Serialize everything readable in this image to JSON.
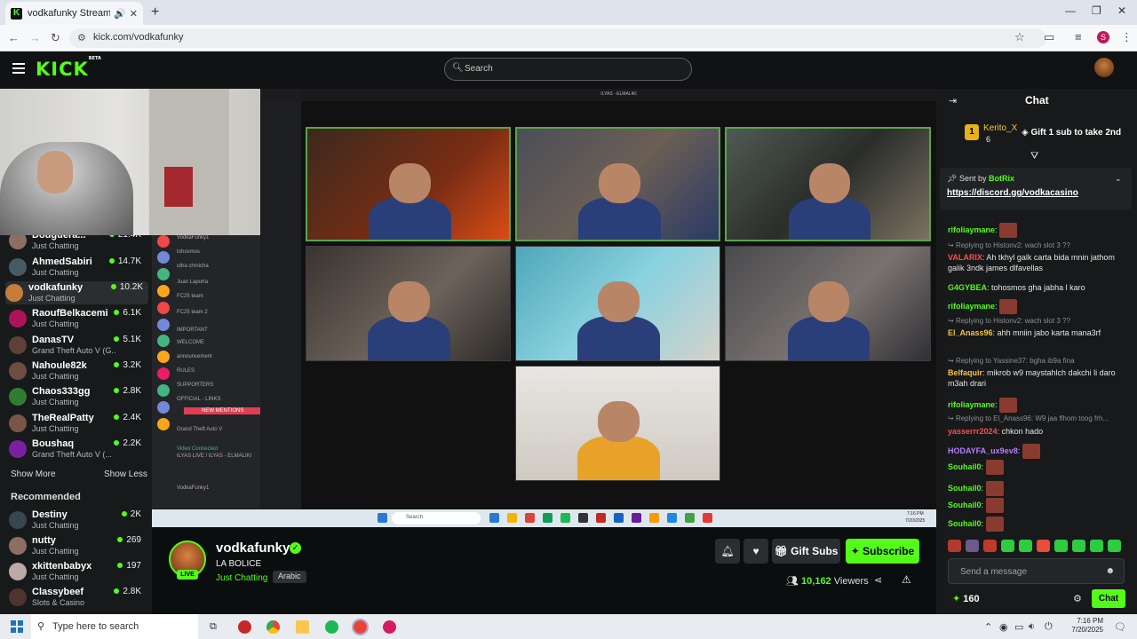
{
  "browser": {
    "tab_title": "vodkafunky Stream - Watch",
    "url": "kick.com/vodkafunky",
    "profile_initial": "S"
  },
  "kick": {
    "logo": "KICK",
    "logo_badge": "BETA",
    "search_placeholder": "Search"
  },
  "sidebar": {
    "following": [
      {
        "name": "Douguera...",
        "category": "Just Chatting",
        "viewers": "21.4K",
        "color": "#8d6e63"
      },
      {
        "name": "AhmedSabiri",
        "category": "Just Chatting",
        "viewers": "14.7K",
        "color": "#455a64"
      },
      {
        "name": "vodkafunky",
        "category": "Just Chatting",
        "viewers": "10.2K",
        "color": "#c77d3a"
      },
      {
        "name": "RaoufBelkacemi",
        "category": "Just Chatting",
        "viewers": "6.1K",
        "color": "#ad1457"
      },
      {
        "name": "DanasTV",
        "category": "Grand Theft Auto V (G...",
        "viewers": "5.1K",
        "color": "#5d4037"
      },
      {
        "name": "Nahoule82k",
        "category": "Just Chatting",
        "viewers": "3.2K",
        "color": "#6d4c41"
      },
      {
        "name": "Chaos333gg",
        "category": "Just Chatting",
        "viewers": "2.8K",
        "color": "#2e7d32"
      },
      {
        "name": "TheRealPatty",
        "category": "Just Chatting",
        "viewers": "2.4K",
        "color": "#795548"
      },
      {
        "name": "Boushaq",
        "category": "Grand Theft Auto V (...",
        "viewers": "2.2K",
        "color": "#7b1fa2"
      }
    ],
    "show_more": "Show More",
    "show_less": "Show Less",
    "recommended_title": "Recommended",
    "recommended": [
      {
        "name": "Destiny",
        "category": "Just Chatting",
        "viewers": "2K",
        "color": "#37474f"
      },
      {
        "name": "nutty",
        "category": "Just Chatting",
        "viewers": "269",
        "color": "#8d6e63"
      },
      {
        "name": "xkittenbabyx",
        "category": "Just Chatting",
        "viewers": "197",
        "color": "#bcaaa4"
      },
      {
        "name": "Classybeef",
        "category": "Slots & Casino",
        "viewers": "2.8K",
        "color": "#4e342e"
      }
    ]
  },
  "stream": {
    "discord_window_title": "ILYAS - ELMALIKI",
    "discord_labels": [
      "VodkaFunky1",
      "tohosmos",
      "ultra chmicha",
      "Juan Laporta",
      "FC25 team",
      "FC25 team 2",
      "IMPORTANT",
      "WELCOME",
      "announcement",
      "RULES",
      "SUPPORTERS",
      "OFFICIAL - LINKS",
      "NEW MENTIONS",
      "Grand Theft Auto V",
      "Video Connected",
      "ILYAS LIVE / ILYAS - ELMALIKI",
      "VodkaFunky1"
    ],
    "taskbar_search": "Search",
    "inner_time": "7:16 PM",
    "inner_date": "7/20/2025"
  },
  "channel": {
    "name": "vodkafunky",
    "title": "LA BOLICE",
    "category": "Just Chatting",
    "tag": "Arabic",
    "live_label": "LIVE",
    "gift_label": "Gift Subs",
    "subscribe_label": "Subscribe",
    "viewers": "10,162",
    "viewers_label": "Viewers"
  },
  "chat": {
    "title": "Chat",
    "top_gifter": "Kerito_X",
    "top_gifter_rank": "1",
    "top_gifter_count": "6",
    "gift_prompt": "Gift 1 sub to take 2nd",
    "pinned_sent_by": "Sent by",
    "pinned_bot": "BotRix",
    "pinned_link": "https://discord.gg/vodkacasino",
    "messages": [
      {
        "type": "msg",
        "user": "rifoliaymane",
        "color": "#53fc18",
        "text": "",
        "emote": true
      },
      {
        "type": "reply",
        "text": "Replying to Histonv2: wach slot 3 ??"
      },
      {
        "type": "msg",
        "user": "VALARIX",
        "color": "#ff4d4d",
        "text": "Ah tkhyl galk carta bida mnin jathom galik 3ndk james dlfavellas",
        "emote": false
      },
      {
        "type": "msg",
        "user": "G4GYBEA",
        "color": "#53fc18",
        "text": "tohosmos gha jabha l karo",
        "emote": false
      },
      {
        "type": "msg",
        "user": "rifoliaymane",
        "color": "#53fc18",
        "text": "",
        "emote": true
      },
      {
        "type": "reply",
        "text": "Replying to Histonv2: wach slot 3 ??"
      },
      {
        "type": "msg",
        "user": "El_Anass96",
        "color": "#f5c344",
        "text": "ahh mniin jabo karta mana3rf",
        "emote": false
      },
      {
        "type": "reply",
        "text": "Replying to Yassine37: bgha ib9a fina"
      },
      {
        "type": "msg",
        "user": "Belfaquir",
        "color": "#f5c344",
        "text": "mikrob w9 maystahlch dakchi li daro m3ah drari",
        "emote": false
      },
      {
        "type": "msg",
        "user": "rifoliaymane",
        "color": "#53fc18",
        "text": "",
        "emote": true
      },
      {
        "type": "reply",
        "text": "Replying to El_Anass96: W9 jaa flhom toog frh..."
      },
      {
        "type": "msg",
        "user": "yasserrr2024",
        "color": "#ff4d4d",
        "text": "chkon hado",
        "emote": false
      },
      {
        "type": "msg",
        "user": "HODAYFA_ux9ev8",
        "color": "#b97cff",
        "text": "",
        "emote": true
      },
      {
        "type": "msg",
        "user": "Souhail0",
        "color": "#53fc18",
        "text": "",
        "emote": true
      },
      {
        "type": "msg",
        "user": "Souhail0",
        "color": "#53fc18",
        "text": "",
        "emote": true
      },
      {
        "type": "msg",
        "user": "Souhail0",
        "color": "#53fc18",
        "text": "",
        "emote": true
      },
      {
        "type": "msg",
        "user": "Souhail0",
        "color": "#53fc18",
        "text": "",
        "emote": true
      }
    ],
    "input_placeholder": "Send a message",
    "points": "160",
    "send_label": "Chat"
  },
  "taskbar": {
    "search_placeholder": "Type here to search",
    "time": "7:16 PM",
    "date": "7/20/2025"
  },
  "colors": {
    "accent": "#53fc18",
    "background": "#0b0e0f",
    "panel": "#171a1b"
  }
}
